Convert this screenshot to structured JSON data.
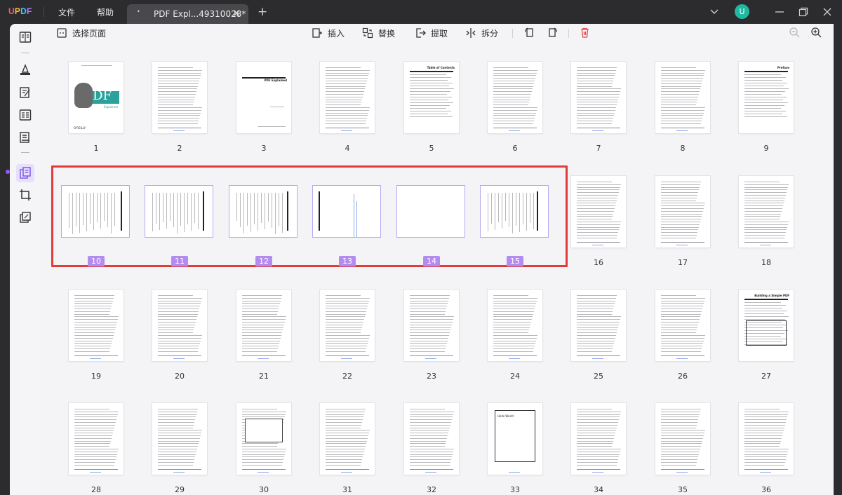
{
  "app": {
    "logo": "UPDF",
    "menu": [
      "文件",
      "帮助"
    ],
    "tab_title": "PDF Expl...49310028*",
    "tab_modified_dot": "•",
    "new_tab": "+",
    "close_tab": "✕",
    "avatar_letter": "U"
  },
  "toolbar": {
    "select_pages": "选择页面",
    "insert": "插入",
    "replace": "替换",
    "extract": "提取",
    "split": "拆分"
  },
  "colors": {
    "accent": "#8a5cf6",
    "selection_border": "#e23b3b",
    "selected_badge": "#b48cf0"
  },
  "pages": [
    {
      "n": "1",
      "selected": false
    },
    {
      "n": "2",
      "selected": false
    },
    {
      "n": "3",
      "selected": false
    },
    {
      "n": "4",
      "selected": false
    },
    {
      "n": "5",
      "selected": false
    },
    {
      "n": "6",
      "selected": false
    },
    {
      "n": "7",
      "selected": false
    },
    {
      "n": "8",
      "selected": false
    },
    {
      "n": "9",
      "selected": false
    },
    {
      "n": "10",
      "selected": true
    },
    {
      "n": "11",
      "selected": true
    },
    {
      "n": "12",
      "selected": true
    },
    {
      "n": "13",
      "selected": true
    },
    {
      "n": "14",
      "selected": true
    },
    {
      "n": "15",
      "selected": true
    },
    {
      "n": "16",
      "selected": false
    },
    {
      "n": "17",
      "selected": false
    },
    {
      "n": "18",
      "selected": false
    },
    {
      "n": "19",
      "selected": false
    },
    {
      "n": "20",
      "selected": false
    },
    {
      "n": "21",
      "selected": false
    },
    {
      "n": "22",
      "selected": false
    },
    {
      "n": "23",
      "selected": false
    },
    {
      "n": "24",
      "selected": false
    },
    {
      "n": "25",
      "selected": false
    },
    {
      "n": "26",
      "selected": false
    },
    {
      "n": "27",
      "selected": false
    },
    {
      "n": "28",
      "selected": false
    },
    {
      "n": "29",
      "selected": false
    },
    {
      "n": "30",
      "selected": false
    },
    {
      "n": "31",
      "selected": false
    },
    {
      "n": "32",
      "selected": false
    },
    {
      "n": "33",
      "selected": false
    },
    {
      "n": "34",
      "selected": false
    },
    {
      "n": "35",
      "selected": false
    },
    {
      "n": "36",
      "selected": false
    }
  ],
  "page_text": {
    "p1_pdf": "PDF",
    "p1_sub": "Explained",
    "p1_pub": "O'REILLY",
    "p3_title": "PDF Explained",
    "p5_title": "Table of Contents",
    "p9_title": "Preface",
    "p27_title": "Building a Simple PDF",
    "p33_text": "Hello World"
  }
}
